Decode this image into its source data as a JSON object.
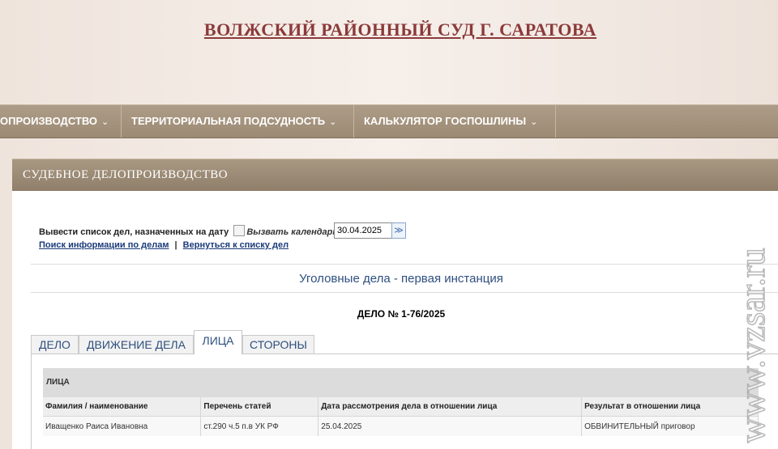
{
  "site": {
    "title": "ВОЛЖСКИЙ РАЙОННЫЙ СУД Г. САРАТОВА"
  },
  "nav": {
    "items": [
      {
        "label": "ОПРОИЗВОДСТВО"
      },
      {
        "label": "ТЕРРИТОРИАЛЬНАЯ ПОДСУДНОСТЬ"
      },
      {
        "label": "КАЛЬКУЛЯТОР ГОСПОШЛИНЫ"
      }
    ],
    "chevron": "⌄"
  },
  "section": {
    "title": "СУДЕБНОЕ ДЕЛОПРОИЗВОДСТВО"
  },
  "filter": {
    "date_label": "Вывести список дел, назначенных на дату",
    "calendar_alt": "Вызвать календарь",
    "date_value": "30.04.2025",
    "go_symbol": "≫",
    "link_search": "Поиск информации по делам",
    "link_separator": "|",
    "link_back": "Вернуться к списку дел"
  },
  "category": "Уголовные дела - первая инстанция",
  "case_number": "ДЕЛО № 1-76/2025",
  "tabs": [
    {
      "label": "ДЕЛО",
      "active": false
    },
    {
      "label": "ДВИЖЕНИЕ ДЕЛА",
      "active": false
    },
    {
      "label": "ЛИЦА",
      "active": true
    },
    {
      "label": "СТОРОНЫ",
      "active": false
    }
  ],
  "persons_panel": {
    "heading": "ЛИЦА",
    "columns": [
      "Фамилия / наименование",
      "Перечень статей",
      "Дата рассмотрения дела в отношении лица",
      "Результат в отношении лица"
    ],
    "rows": [
      [
        "Иващенко Раиса Ивановна",
        "ст.290 ч.5 п.в УК РФ",
        "25.04.2025",
        "ОБВИНИТЕЛЬНЫЙ приговор"
      ]
    ]
  },
  "watermark": "www.vzsar.ru"
}
